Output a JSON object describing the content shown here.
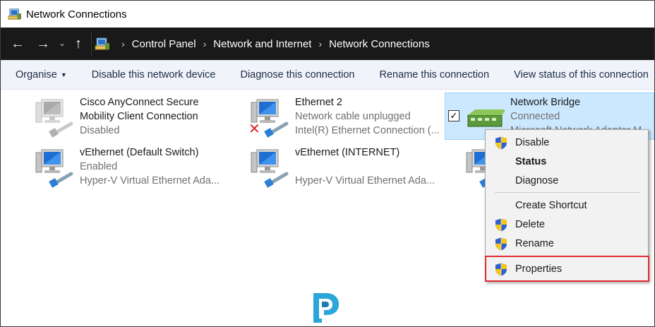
{
  "window": {
    "title": "Network Connections"
  },
  "navigation": {
    "back": "←",
    "forward": "→",
    "recent": "⌄",
    "up": "↑",
    "breadcrumbs": [
      "Control Panel",
      "Network and Internet",
      "Network Connections"
    ]
  },
  "toolbar": {
    "organise": "Organise",
    "disable": "Disable this network device",
    "diagnose": "Diagnose this connection",
    "rename": "Rename this connection",
    "view_status": "View status of this connection"
  },
  "connections": [
    {
      "name": "Cisco AnyConnect Secure",
      "name2": "Mobility Client Connection",
      "status": "Disabled",
      "adapter": ""
    },
    {
      "name": "Ethernet 2",
      "status": "Network cable unplugged",
      "adapter": "Intel(R) Ethernet Connection (..."
    },
    {
      "name": "Network Bridge",
      "status": "Connected",
      "adapter": "Microsoft Network Adapter M..."
    },
    {
      "name": "vEthernet (Default Switch)",
      "status": "Enabled",
      "adapter": "Hyper-V Virtual Ethernet Ada..."
    },
    {
      "name": "vEthernet (INTERNET)",
      "status": "",
      "adapter": "Hyper-V Virtual Ethernet Ada..."
    }
  ],
  "context_menu": {
    "disable": "Disable",
    "status": "Status",
    "diagnose": "Diagnose",
    "create_shortcut": "Create Shortcut",
    "delete": "Delete",
    "rename": "Rename",
    "properties": "Properties"
  },
  "colors": {
    "selection": "#cce8ff",
    "highlight_box": "#e22b33",
    "address_bar": "#191919",
    "command_bar": "#f0f4fa",
    "logo": "#2aa6d8"
  }
}
